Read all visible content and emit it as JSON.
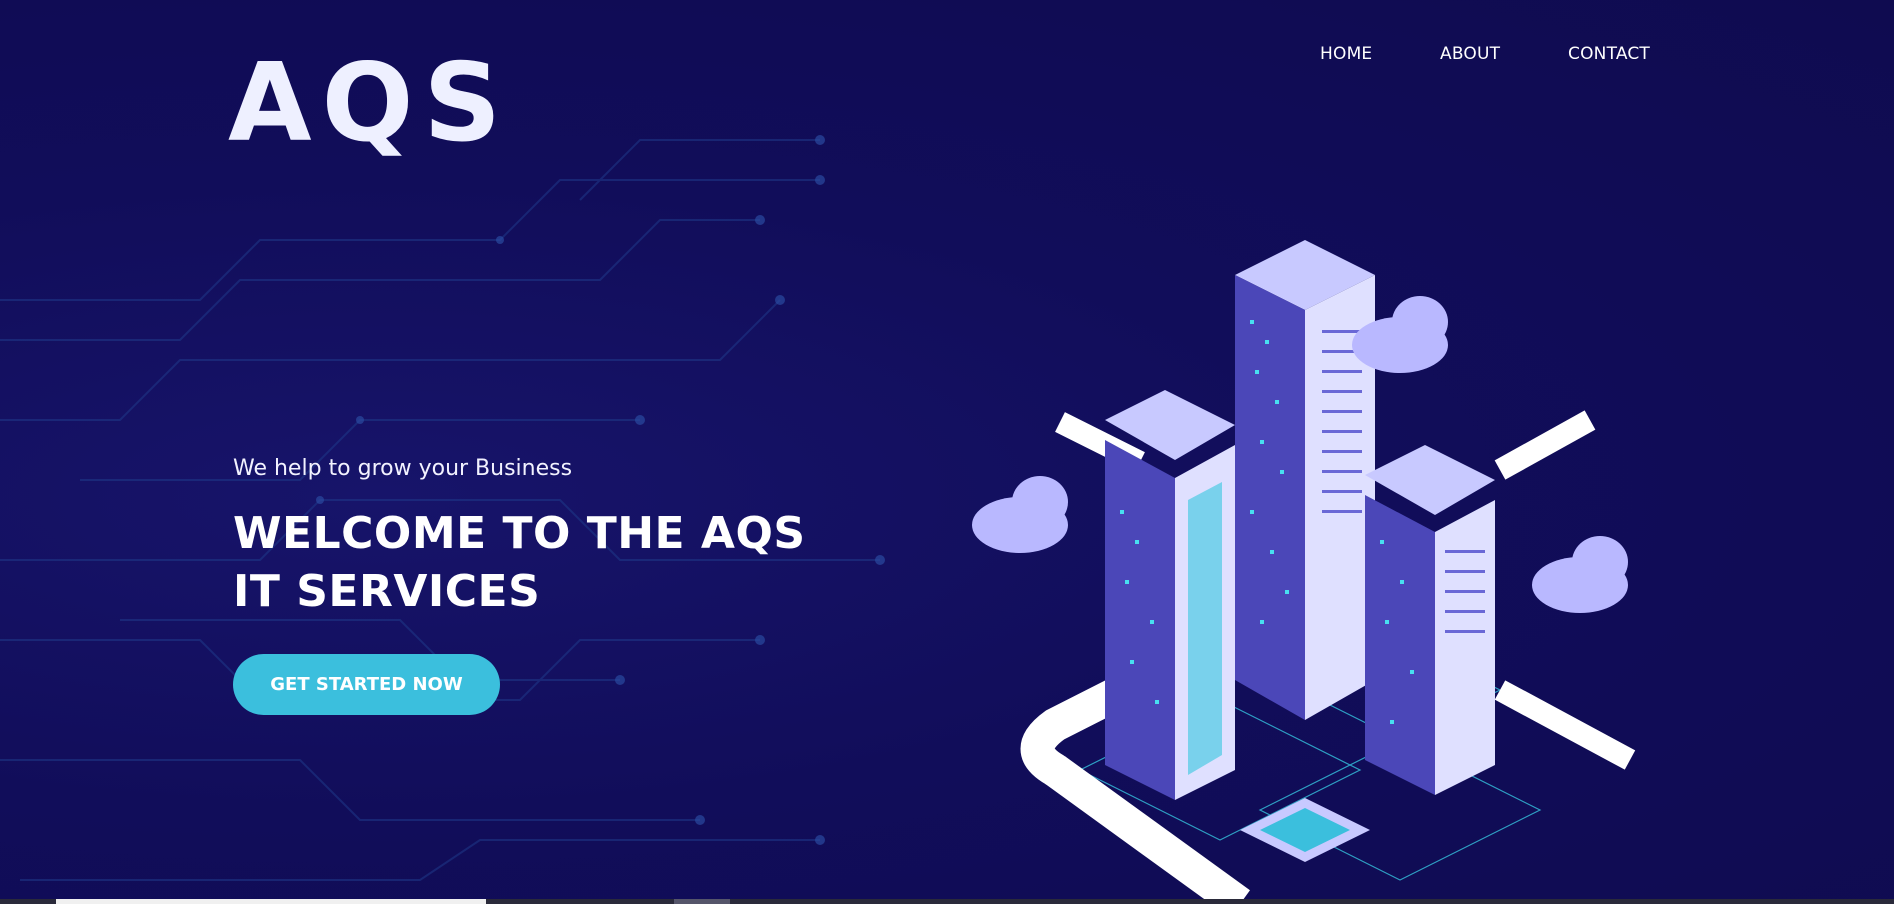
{
  "logo": {
    "text": "AQS"
  },
  "nav": {
    "items": [
      {
        "label": "HOME",
        "active": true
      },
      {
        "label": "ABOUT",
        "active": false
      },
      {
        "label": "CONTACT",
        "active": false
      }
    ]
  },
  "hero": {
    "tagline": "We help to grow your Business",
    "headline_line1": "WELCOME TO THE AQS",
    "headline_line2": "IT SERVICES",
    "cta_label": "GET STARTED NOW"
  },
  "colors": {
    "background": "#100c57",
    "accent": "#3bbfdd",
    "text": "#ffffff"
  },
  "icons": [
    "circuit-background",
    "isometric-city-illustration",
    "cloud-icon"
  ]
}
